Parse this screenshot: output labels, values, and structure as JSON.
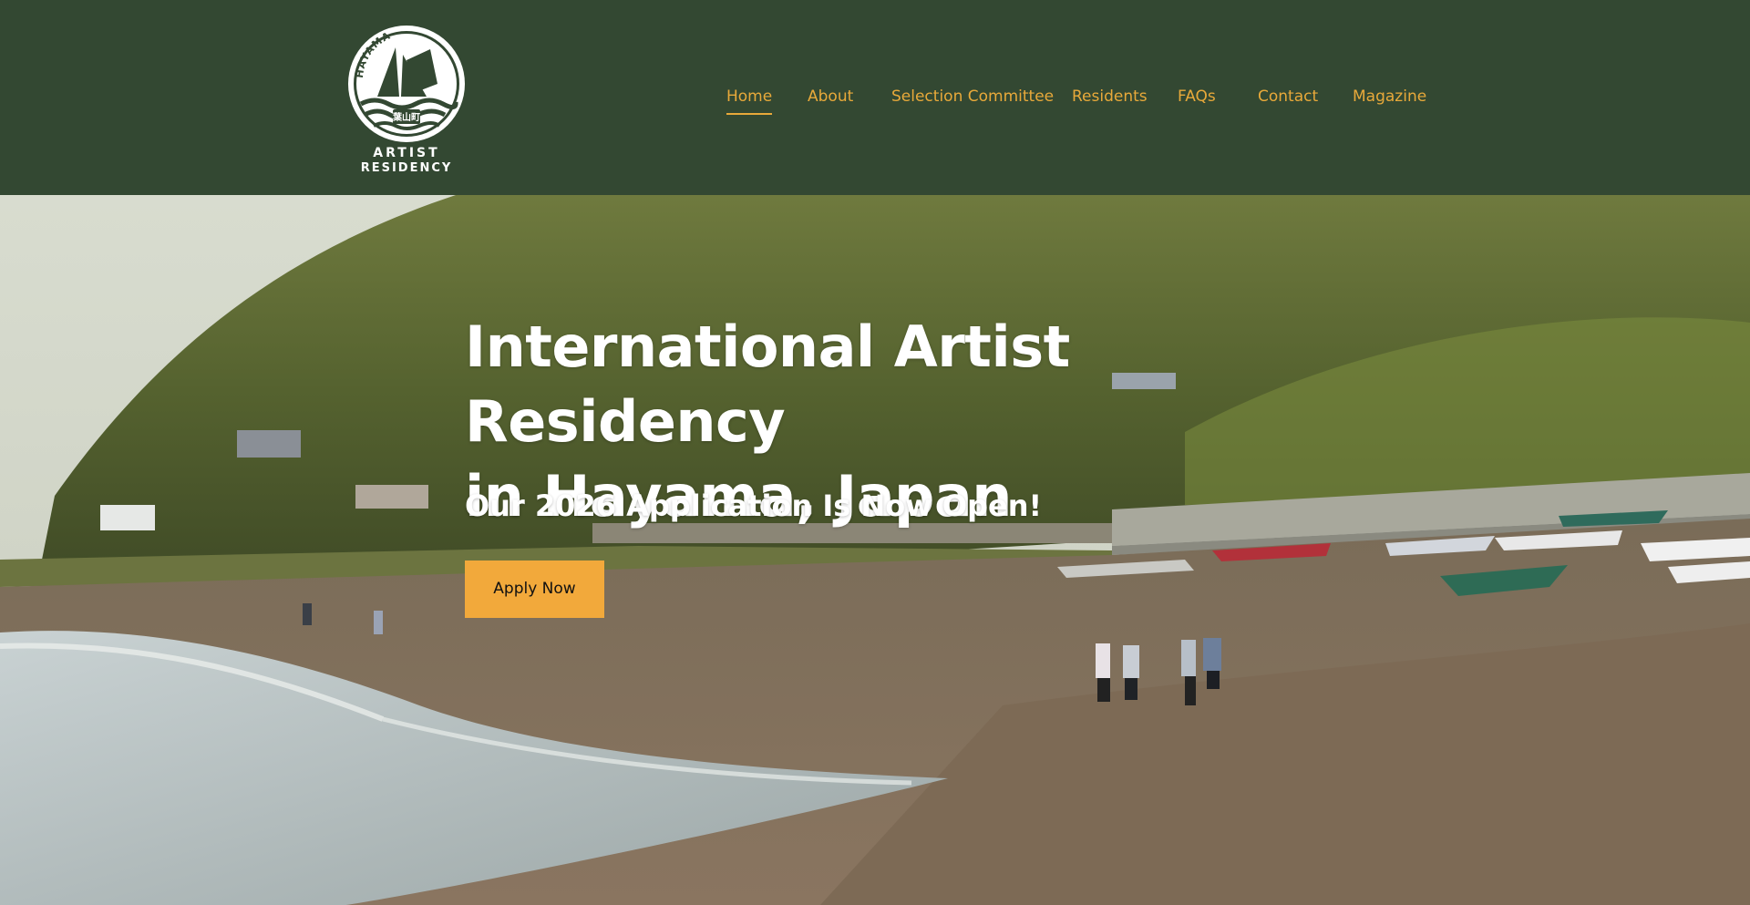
{
  "header": {
    "logo": {
      "arc_text": "HAYAMA",
      "stamp_text": "葉山町",
      "line1": "ARTIST",
      "line2": "RESIDENCY"
    },
    "nav": [
      {
        "label": "Home",
        "active": true
      },
      {
        "label": "About",
        "active": false
      },
      {
        "label": "Selection Committee",
        "active": false
      },
      {
        "label": "Residents",
        "active": false
      },
      {
        "label": "FAQs",
        "active": false
      },
      {
        "label": "Contact",
        "active": false
      },
      {
        "label": "Magazine",
        "active": false
      }
    ]
  },
  "hero": {
    "title_line1": "International Artist Residency",
    "title_line2": "in Hayama, Japan",
    "subtitle": "Our 2026 Application Is Now Open!",
    "cta_label": "Apply Now"
  },
  "colors": {
    "header_bg": "#334832",
    "nav_text": "#e8a93a",
    "cta_bg": "#f2a93b",
    "hero_text": "#ffffff"
  }
}
